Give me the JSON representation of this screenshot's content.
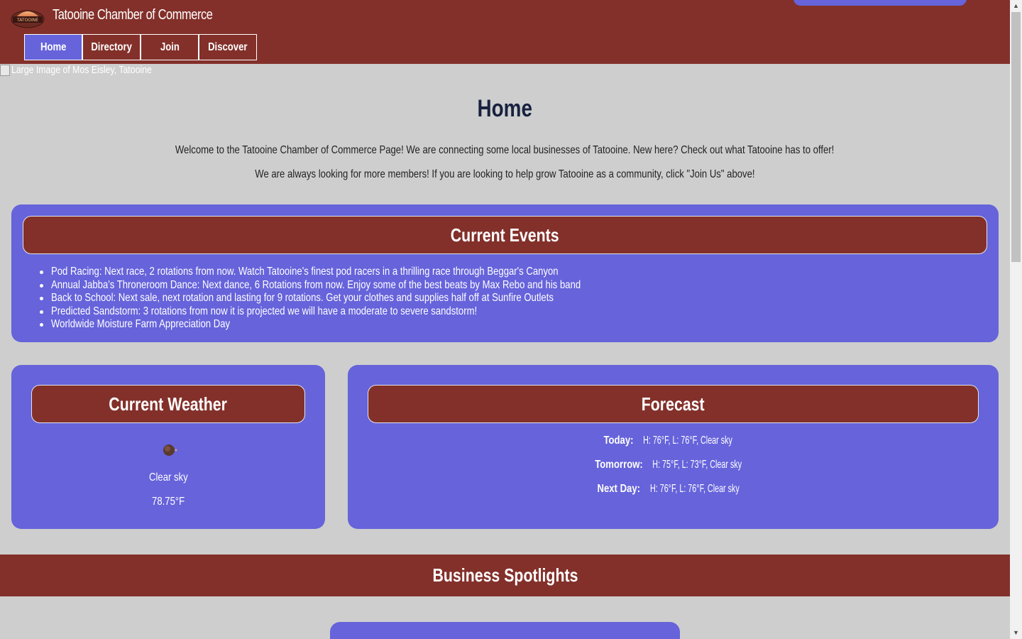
{
  "header": {
    "site_title": "Tatooine Chamber of Commerce",
    "logo_text": "TATOOINE",
    "nav": [
      {
        "label": "Home",
        "active": true
      },
      {
        "label": "Directory",
        "active": false
      },
      {
        "label": "Join",
        "active": false
      },
      {
        "label": "Discover",
        "active": false
      }
    ]
  },
  "hero": {
    "alt_text": "Large Image of Mos Eisley, Tatooine"
  },
  "main": {
    "title": "Home",
    "intro_1": "Welcome to the Tatooine Chamber of Commerce Page! We are connecting some local businesses of Tatooine. New here? Check out what Tatooine has to offer!",
    "intro_2": "We are always looking for more members! If you are looking to help grow Tatooine as a community, click \"Join Us\" above!"
  },
  "events": {
    "title": "Current Events",
    "items": [
      "Pod Racing: Next race, 2 rotations from now. Watch Tatooine's finest pod racers in a thrilling race through Beggar's Canyon",
      "Annual Jabba's Throneroom Dance: Next dance, 6 Rotations from now. Enjoy some of the best beats by Max Rebo and his band",
      "Back to School: Next sale, next rotation and lasting for 9 rotations. Get your clothes and supplies half off at Sunfire Outlets",
      "Predicted Sandstorm: 3 rotations from now it is projected we will have a moderate to severe sandstorm!",
      "Worldwide Moisture Farm Appreciation Day"
    ]
  },
  "weather": {
    "title": "Current Weather",
    "icon": "weather-icon",
    "description": "Clear sky",
    "temperature": "78.75°F"
  },
  "forecast": {
    "title": "Forecast",
    "days": [
      {
        "label": "Today:",
        "detail": " H: 76°F, L: 76°F, Clear sky"
      },
      {
        "label": "Tomorrow:",
        "detail": " H: 75°F, L: 73°F, Clear sky"
      },
      {
        "label": "Next Day:",
        "detail": " H: 76°F, L: 76°F, Clear sky"
      }
    ]
  },
  "spotlights": {
    "title": "Business Spotlights"
  },
  "colors": {
    "header_bg": "#83302a",
    "accent": "#6663db",
    "page_bg": "#cecece",
    "title_text": "#18223f"
  }
}
